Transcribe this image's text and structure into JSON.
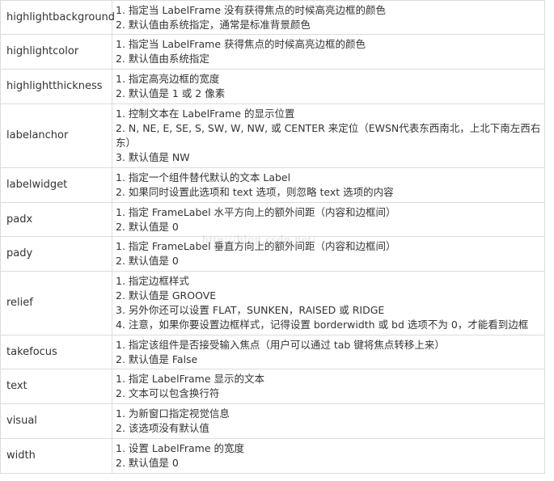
{
  "rows": [
    {
      "name": "highlightbackground",
      "lines": [
        "1. 指定当 LabelFrame 没有获得焦点的时候高亮边框的颜色",
        "2. 默认值由系统指定，通常是标准背景颜色"
      ]
    },
    {
      "name": "highlightcolor",
      "lines": [
        "1. 指定当 LabelFrame 获得焦点的时候高亮边框的颜色",
        "2. 默认值由系统指定"
      ]
    },
    {
      "name": "highlightthickness",
      "lines": [
        "1. 指定高亮边框的宽度",
        "2. 默认值是 1 或 2 像素"
      ]
    },
    {
      "name": "labelanchor",
      "lines": [
        "1. 控制文本在 LabelFrame 的显示位置",
        "2. N, NE, E, SE, S, SW, W, NW, 或 CENTER 来定位（EWSN代表东西南北，上北下南左西右东）",
        "3. 默认值是 NW"
      ]
    },
    {
      "name": "labelwidget",
      "lines": [
        "1. 指定一个组件替代默认的文本 Label",
        "2. 如果同时设置此选项和 text 选项，则忽略 text 选项的内容"
      ]
    },
    {
      "name": "padx",
      "lines": [
        "1. 指定 FrameLabel 水平方向上的额外间距（内容和边框间）",
        "2. 默认值是 0"
      ]
    },
    {
      "name": "pady",
      "lines": [
        "1. 指定 FrameLabel 垂直方向上的额外间距（内容和边框间）",
        "2. 默认值是 0"
      ]
    },
    {
      "name": "relief",
      "lines": [
        "1. 指定边框样式",
        "2. 默认值是 GROOVE",
        "3. 另外你还可以设置 FLAT，SUNKEN，RAISED 或 RIDGE",
        "4. 注意，如果你要设置边框样式，记得设置 borderwidth 或 bd 选项不为 0，才能看到边框"
      ]
    },
    {
      "name": "takefocus",
      "lines": [
        "1. 指定该组件是否接受输入焦点（用户可以通过 tab 键将焦点转移上来）",
        "2. 默认值是 False"
      ]
    },
    {
      "name": "text",
      "lines": [
        "1. 指定 LabelFrame 显示的文本",
        "2. 文本可以包含换行符"
      ]
    },
    {
      "name": "visual",
      "lines": [
        "1. 为新窗口指定视觉信息",
        "2. 该选项没有默认值"
      ]
    },
    {
      "name": "width",
      "lines": [
        "1. 设置 LabelFrame 的宽度",
        "2. 默认值是 0"
      ]
    }
  ],
  "watermark": "http://blog.csdn.net/"
}
